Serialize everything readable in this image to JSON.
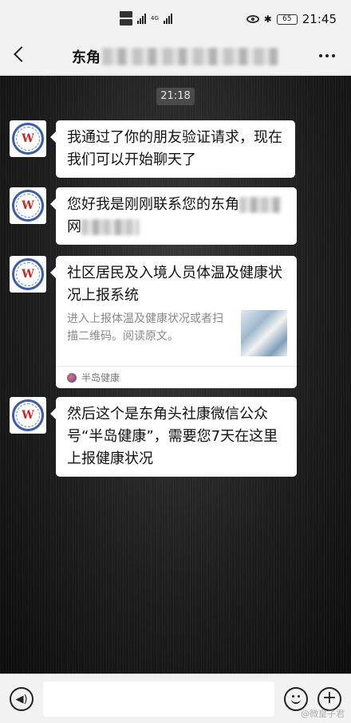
{
  "status_bar": {
    "network_label": "4G",
    "battery": "65",
    "time": "21:45"
  },
  "header": {
    "title": "东角"
  },
  "chat": {
    "timestamp": "21:18",
    "messages": [
      {
        "text": "我通过了你的朋友验证请求，现在我们可以开始聊天了"
      },
      {
        "text_before_blur": "您好我是刚刚联系您的东角",
        "text_line2": "网"
      },
      {
        "card_title": "社区居民及入境人员体温及健康状况上报系统",
        "card_desc": "进入上报体温及健康状况或者扫描二维码。阅读原文。",
        "card_account": "半岛健康"
      },
      {
        "text": "然后这个是东角头社康微信公众号“半岛健康”，需要您7天在这里上报健康状况"
      }
    ]
  },
  "watermark": "@微皇子君"
}
